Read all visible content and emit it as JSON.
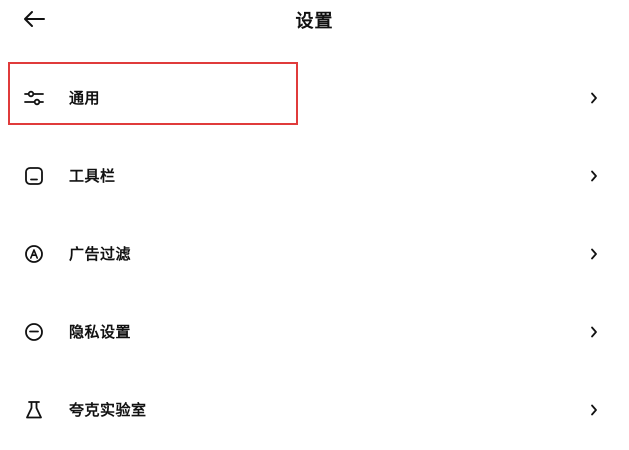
{
  "header": {
    "title": "设置",
    "back_icon": "arrow-left-icon"
  },
  "menu": {
    "items": [
      {
        "label": "通用",
        "icon": "sliders-icon"
      },
      {
        "label": "工具栏",
        "icon": "toolbar-icon"
      },
      {
        "label": "广告过滤",
        "icon": "ad-block-icon"
      },
      {
        "label": "隐私设置",
        "icon": "privacy-mask-icon"
      },
      {
        "label": "夸克实验室",
        "icon": "lab-flask-icon"
      }
    ],
    "chevron_icon": "chevron-right-icon"
  },
  "highlight": {
    "target": "通用",
    "color": "#e03b3b"
  }
}
